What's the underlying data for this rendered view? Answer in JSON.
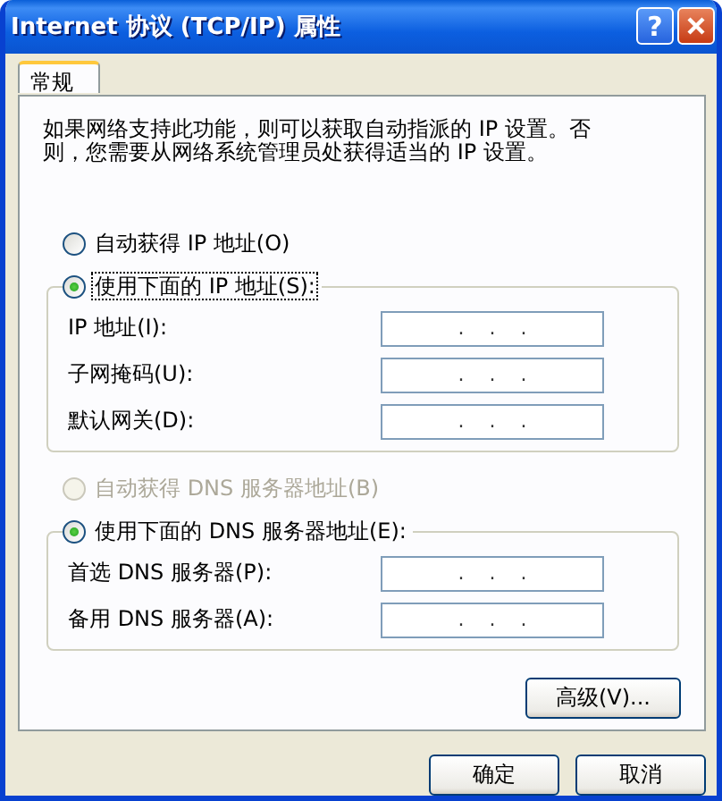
{
  "window": {
    "title": "Internet 协议 (TCP/IP) 属性",
    "help_button": "?"
  },
  "tabs": [
    {
      "label": "常规",
      "selected": true
    }
  ],
  "description": "如果网络支持此功能，则可以获取自动指派的 IP 设置。否则，您需要从网络系统管理员处获得适当的 IP 设置。",
  "ip_group": {
    "options": [
      {
        "label": "自动获得 IP 地址(O)",
        "selected": false,
        "disabled": false,
        "focused": false
      },
      {
        "label": "使用下面的 IP 地址(S):",
        "selected": true,
        "disabled": false,
        "focused": true
      }
    ],
    "fields": [
      {
        "label": "IP 地址(I):",
        "value": ".    .    ."
      },
      {
        "label": "子网掩码(U):",
        "value": ".    .    ."
      },
      {
        "label": "默认网关(D):",
        "value": ".    .    ."
      }
    ]
  },
  "dns_group": {
    "options": [
      {
        "label": "自动获得 DNS 服务器地址(B)",
        "selected": false,
        "disabled": true,
        "focused": false
      },
      {
        "label": "使用下面的 DNS 服务器地址(E):",
        "selected": true,
        "disabled": false,
        "focused": false
      }
    ],
    "fields": [
      {
        "label": "首选 DNS 服务器(P):",
        "value": ".    .    ."
      },
      {
        "label": "备用 DNS 服务器(A):",
        "value": ".    .    ."
      }
    ]
  },
  "advanced_button": "高级(V)...",
  "buttons": [
    "确定",
    "取消"
  ]
}
